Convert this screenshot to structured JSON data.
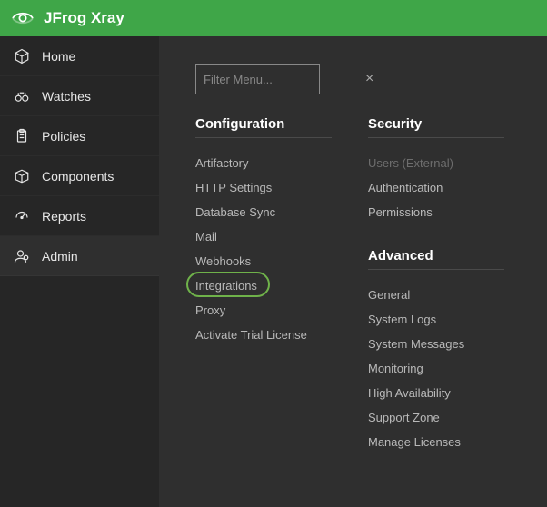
{
  "header": {
    "title": "JFrog Xray"
  },
  "sidebar": {
    "items": [
      {
        "key": "home",
        "label": "Home"
      },
      {
        "key": "watches",
        "label": "Watches"
      },
      {
        "key": "policies",
        "label": "Policies"
      },
      {
        "key": "components",
        "label": "Components"
      },
      {
        "key": "reports",
        "label": "Reports"
      },
      {
        "key": "admin",
        "label": "Admin"
      }
    ]
  },
  "filter": {
    "placeholder": "Filter Menu..."
  },
  "sections": {
    "configuration": {
      "title": "Configuration",
      "items": {
        "artifactory": "Artifactory",
        "http": "HTTP Settings",
        "dbsync": "Database Sync",
        "mail": "Mail",
        "webhooks": "Webhooks",
        "integrations": "Integrations",
        "proxy": "Proxy",
        "license": "Activate Trial License"
      }
    },
    "security": {
      "title": "Security",
      "items": {
        "users": "Users (External)",
        "auth": "Authentication",
        "perm": "Permissions"
      }
    },
    "advanced": {
      "title": "Advanced",
      "items": {
        "general": "General",
        "syslogs": "System Logs",
        "sysmsg": "System Messages",
        "monitor": "Monitoring",
        "ha": "High Availability",
        "support": "Support Zone",
        "licenses": "Manage Licenses"
      }
    }
  }
}
